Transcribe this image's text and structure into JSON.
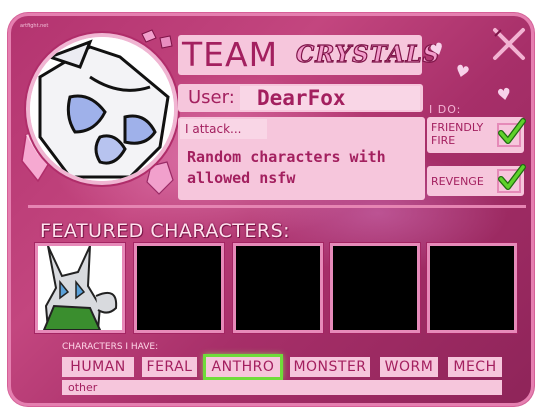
{
  "watermark": "artfight.net",
  "title": {
    "team": "TEAM",
    "team_name": "CRYSTALS"
  },
  "user": {
    "label": "User:",
    "name": "DearFox"
  },
  "attack": {
    "label": "I attack...",
    "text": "Random characters with allowed nsfw"
  },
  "i_do": {
    "title": "I DO:",
    "options": [
      {
        "label": "FRIENDLY FIRE",
        "checked": true
      },
      {
        "label": "REVENGE",
        "checked": true
      }
    ]
  },
  "featured": {
    "title": "FEATURED CHARACTERS:",
    "slot_count": 5
  },
  "characters_i_have": {
    "title": "CHARACTERS I HAVE:",
    "tags": [
      {
        "label": "HUMAN",
        "selected": false
      },
      {
        "label": "FERAL",
        "selected": false
      },
      {
        "label": "ANTHRO",
        "selected": true
      },
      {
        "label": "MONSTER",
        "selected": false
      },
      {
        "label": "WORM",
        "selected": false
      },
      {
        "label": "MECH",
        "selected": false
      }
    ],
    "other_label": "other"
  },
  "colors": {
    "card_background": "#b3336f",
    "panel": "#f6c6dc",
    "text_accent": "#a3205f",
    "check_green": "#5fd12b",
    "selected_glow": "#6fdc3a"
  },
  "icons": [
    "avatar-portrait",
    "crystal-icon",
    "heart-icon",
    "crossed-swords-icon",
    "checkmark-icon"
  ]
}
